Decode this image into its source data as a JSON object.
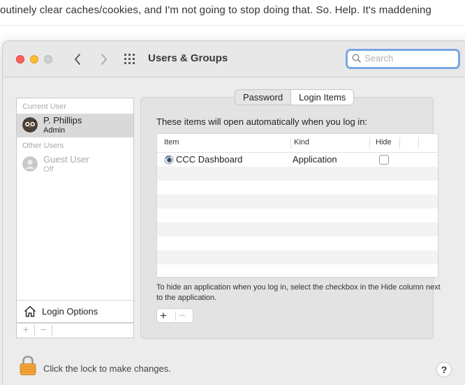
{
  "background": {
    "text": "outinely clear caches/cookies, and I'm not going to stop doing that. So. Help. It's maddening"
  },
  "window": {
    "title": "Users & Groups",
    "search_placeholder": "Search",
    "colors": {
      "close": "#fe5f57",
      "minimize": "#febc2e",
      "accent": "#7aa6e6"
    }
  },
  "sidebar": {
    "current_user_label": "Current User",
    "current_user": {
      "name": "P. Phillips",
      "role": "Admin"
    },
    "other_users_label": "Other Users",
    "other_user": {
      "name": "Guest User",
      "role": "Off"
    },
    "login_options": "Login Options",
    "add_label": "+",
    "remove_label": "−"
  },
  "tabs": {
    "password": "Password",
    "login_items": "Login Items",
    "selected": "Login Items"
  },
  "main": {
    "intro": "These items will open automatically when you log in:",
    "columns": {
      "item": "Item",
      "kind": "Kind",
      "hide": "Hide"
    },
    "rows": [
      {
        "item": "CCC Dashboard",
        "kind": "Application",
        "hide": false,
        "icon": "ccc-dashboard-icon"
      }
    ],
    "hint": "To hide an application when you log in, select the checkbox in the Hide column next to the application.",
    "add_label": "+",
    "remove_label": "−"
  },
  "footer": {
    "lock_text": "Click the lock to make changes.",
    "help_label": "?"
  }
}
